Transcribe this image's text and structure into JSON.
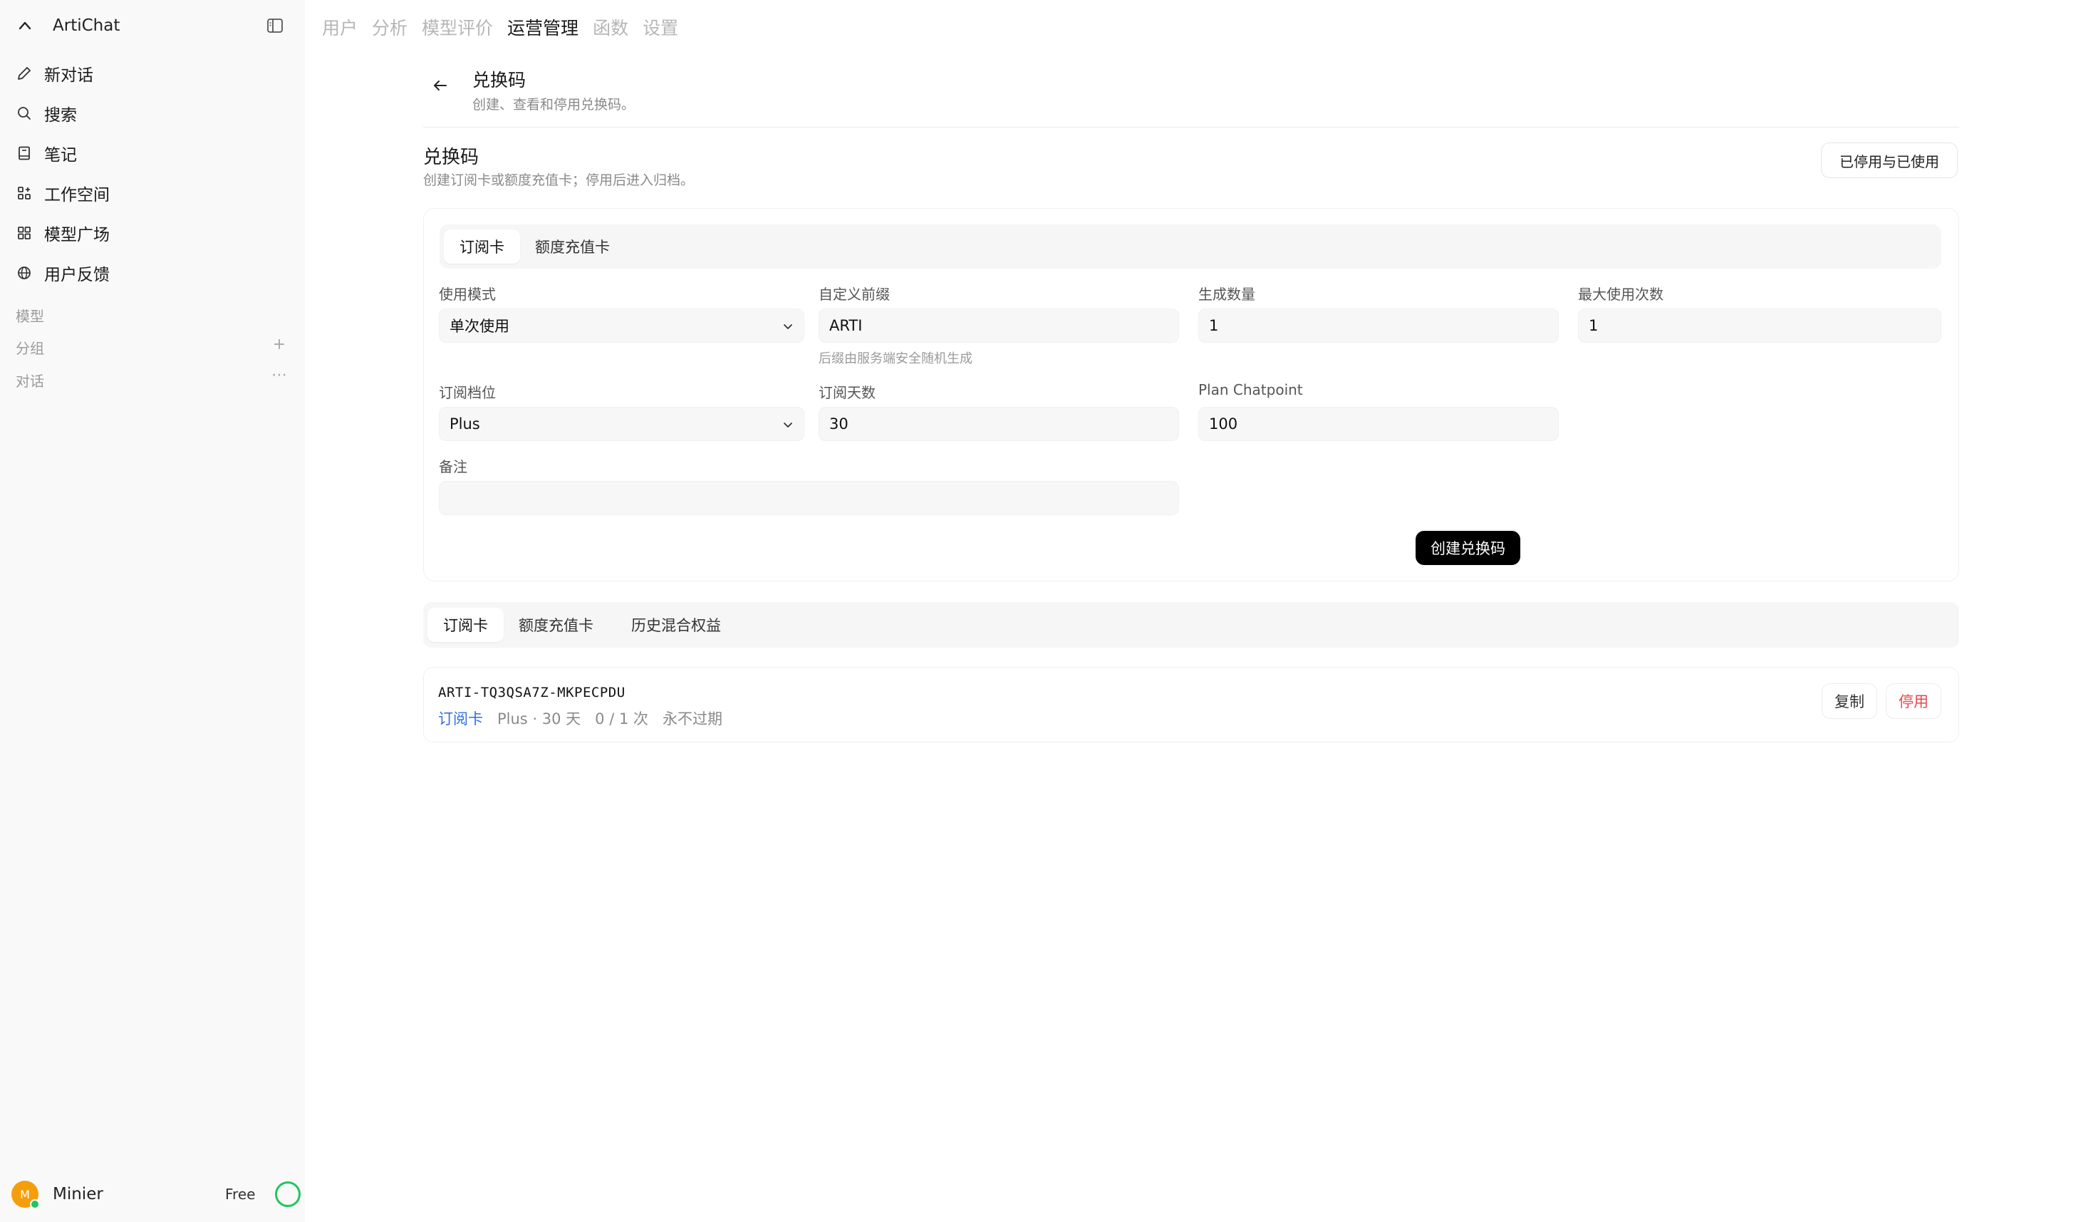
{
  "app": {
    "name": "ArtiChat"
  },
  "sidebar": {
    "nav": [
      {
        "label": "新对话",
        "icon": "pencil-icon"
      },
      {
        "label": "搜索",
        "icon": "search-icon"
      },
      {
        "label": "笔记",
        "icon": "notebook-icon"
      },
      {
        "label": "工作空间",
        "icon": "workspace-icon"
      },
      {
        "label": "模型广场",
        "icon": "grid-icon"
      },
      {
        "label": "用户反馈",
        "icon": "globe-icon"
      }
    ],
    "sections": {
      "models": "模型",
      "groups": "分组",
      "chats": "对话"
    },
    "user": {
      "initial": "M",
      "name": "Minier",
      "plan": "Free"
    }
  },
  "top_tabs": [
    "用户",
    "分析",
    "模型评价",
    "运营管理",
    "函数",
    "设置"
  ],
  "top_tab_active": "运营管理",
  "header": {
    "title": "兑换码",
    "subtitle": "创建、查看和停用兑换码。"
  },
  "section": {
    "title": "兑换码",
    "subtitle": "创建订阅卡或额度充值卡；停用后进入归档。",
    "archive_button": "已停用与已使用"
  },
  "create_form": {
    "tabs": [
      "订阅卡",
      "额度充值卡"
    ],
    "usage_mode": {
      "label": "使用模式",
      "value": "单次使用"
    },
    "prefix": {
      "label": "自定义前缀",
      "value": "ARTI",
      "hint": "后缀由服务端安全随机生成"
    },
    "quantity": {
      "label": "生成数量",
      "value": "1"
    },
    "max_uses": {
      "label": "最大使用次数",
      "value": "1"
    },
    "tier": {
      "label": "订阅档位",
      "value": "Plus"
    },
    "days": {
      "label": "订阅天数",
      "value": "30"
    },
    "chatpoint": {
      "label": "Plan Chatpoint",
      "value": "100"
    },
    "note": {
      "label": "备注",
      "value": ""
    },
    "submit": "创建兑换码"
  },
  "list_tabs": [
    "订阅卡",
    "额度充值卡",
    "历史混合权益"
  ],
  "codes": [
    {
      "code": "ARTI-TQ3QSA7Z-MKPECPDU",
      "type": "订阅卡",
      "plan": "Plus · 30 天",
      "usage": "0 / 1 次",
      "expiry": "永不过期",
      "copy_label": "复制",
      "disable_label": "停用"
    }
  ],
  "colors": {
    "accent_blue": "#2f6fe0",
    "danger": "#e5484d",
    "online": "#22c55e",
    "avatar": "#f59e0b"
  }
}
